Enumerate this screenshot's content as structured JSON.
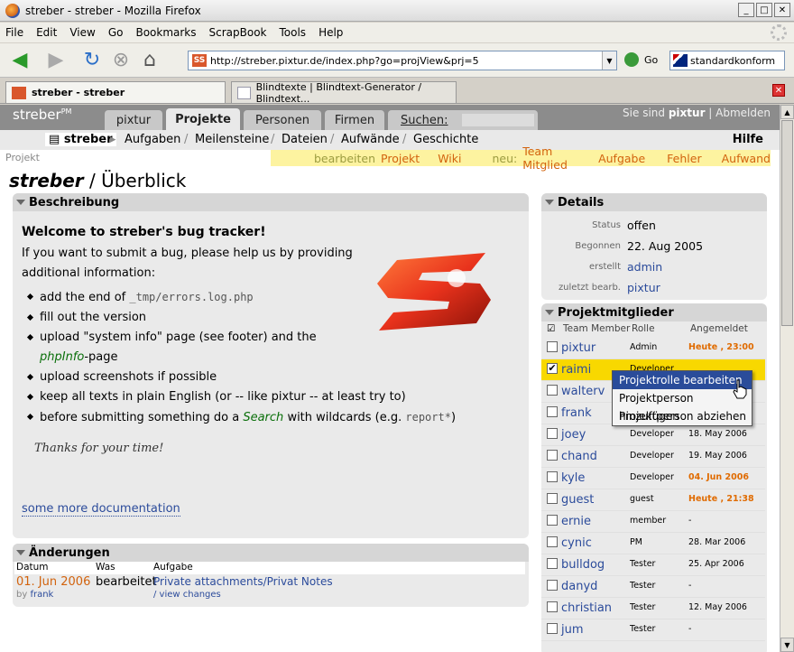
{
  "window": {
    "title": "streber - streber - Mozilla Firefox"
  },
  "menu": [
    "File",
    "Edit",
    "View",
    "Go",
    "Bookmarks",
    "ScrapBook",
    "Tools",
    "Help"
  ],
  "nav": {
    "url": "http://streber.pixtur.de/index.php?go=projView&prj=5",
    "go_label": "Go",
    "search_engine": "standardkonform"
  },
  "tabs": [
    {
      "label": "streber - streber"
    },
    {
      "label": "Blindtexte | Blindtext-Generator / Blindtext..."
    }
  ],
  "header": {
    "logo": "streber",
    "logo_sup": "PM",
    "tabs": [
      "pixtur",
      "Projekte",
      "Personen",
      "Firmen",
      "Suchen:"
    ],
    "user_prefix": "Sie sind",
    "user": "pixtur",
    "logout": "Abmelden"
  },
  "subnav": {
    "home": "streber",
    "items": [
      "Aufgaben",
      "Meilensteine",
      "Dateien",
      "Aufwände",
      "Geschichte"
    ],
    "help": "Hilfe"
  },
  "actions": {
    "context": "Projekt",
    "edit_label": "bearbeiten",
    "edit": "Projekt",
    "wiki": "Wiki",
    "new_label": "neu:",
    "new_items": [
      "Team Mitglied",
      "Aufgabe",
      "Fehler",
      "Aufwand"
    ]
  },
  "page": {
    "title_project": "streber",
    "title_rest": "/ Überblick"
  },
  "description": {
    "heading": "Beschreibung",
    "welcome": "Welcome to streber's bug tracker!",
    "intro": "If you want to submit a bug, please help us by providing additional information:",
    "items": {
      "a": "add the end of",
      "a_code": "_tmp/errors.log.php",
      "b": "fill out the version",
      "c": "upload \"system info\" page (see footer) and the",
      "c_link": "phpInfo",
      "c_tail": "-page",
      "d": "upload screenshots if possible",
      "e": "keep all texts in plain English (or -- like pixtur -- at least try to)",
      "f": "before submitting something do a",
      "f_link": "Search",
      "f_mid": "with wildcards (e.g.",
      "f_code": "report*",
      "f_tail": ")"
    },
    "thanks": "Thanks for your time!",
    "more": "some more documentation"
  },
  "changes": {
    "heading": "Änderungen",
    "cols": [
      "Datum",
      "Was",
      "Aufgabe"
    ],
    "date": "01. Jun 2006",
    "by_label": "by",
    "by": "frank",
    "what": "bearbeitet",
    "task": "Private attachments/Privat Notes",
    "view": "/ view changes"
  },
  "details": {
    "heading": "Details",
    "rows": [
      {
        "label": "Status",
        "value": "offen"
      },
      {
        "label": "Begonnen",
        "value": "22. Aug 2005"
      },
      {
        "label": "erstellt",
        "value": "admin"
      },
      {
        "label": "zuletzt bearb.",
        "value": "pixtur"
      }
    ]
  },
  "members": {
    "heading": "Projektmitglieder",
    "cols": [
      "Team Member",
      "Rolle",
      "Angemeldet"
    ],
    "rows": [
      {
        "name": "pixtur",
        "role": "Admin",
        "date": "Heute , 23:00"
      },
      {
        "name": "raimi",
        "role": "Developer",
        "date": ""
      },
      {
        "name": "walterv",
        "role": "",
        "date": ""
      },
      {
        "name": "frank",
        "role": "",
        "date": ""
      },
      {
        "name": "joey",
        "role": "Developer",
        "date": "18. May 2006"
      },
      {
        "name": "chand",
        "role": "Developer",
        "date": "19. May 2006"
      },
      {
        "name": "kyle",
        "role": "Developer",
        "date": "04. Jun 2006"
      },
      {
        "name": "guest",
        "role": "guest",
        "date": "Heute , 21:38"
      },
      {
        "name": "ernie",
        "role": "member",
        "date": "-"
      },
      {
        "name": "cynic",
        "role": "PM",
        "date": "28. Mar 2006"
      },
      {
        "name": "bulldog",
        "role": "Tester",
        "date": "25. Apr 2006"
      },
      {
        "name": "danyd",
        "role": "Tester",
        "date": "-"
      },
      {
        "name": "christian",
        "role": "Tester",
        "date": "12. May 2006"
      },
      {
        "name": "jum",
        "role": "Tester",
        "date": "-"
      }
    ]
  },
  "context_menu": [
    "Projektrolle bearbeiten",
    "Projektperson hinzufügen",
    "Projektperson abziehen"
  ],
  "colors": {
    "accent": "#d2630e",
    "link": "#2b4b9b",
    "selected_row": "#f8d800"
  }
}
